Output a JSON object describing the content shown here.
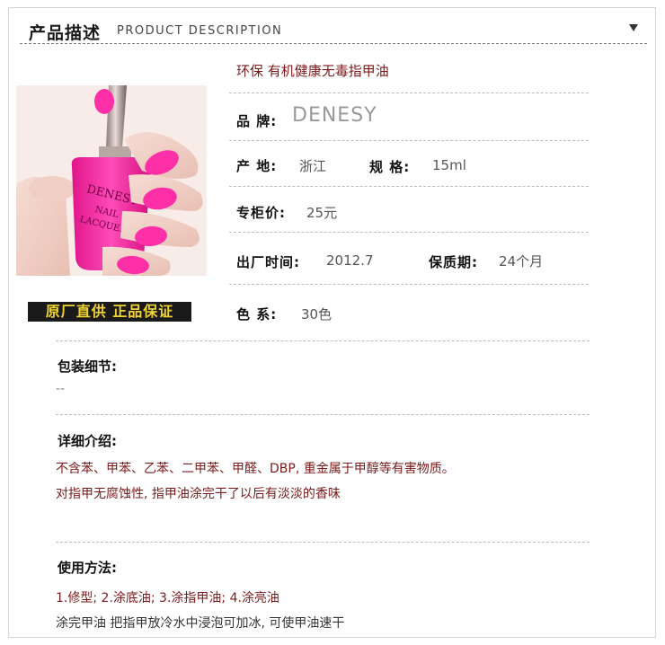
{
  "header": {
    "title_cn": "产品描述",
    "title_en": "PRODUCT DESCRIPTION"
  },
  "photo": {
    "bottle_brand": "DENESY",
    "bottle_line1": "NAIL",
    "bottle_line2": "LACQUER",
    "polish_color": "#ff2fa8"
  },
  "badge": {
    "text": "原厂直供 正品保证"
  },
  "specs": {
    "title": "环保 有机健康无毒指甲油",
    "brand_label": "品 牌:",
    "brand_value": "DENESY",
    "origin_label": "产 地:",
    "origin_value": "浙江",
    "size_label": "规 格:",
    "size_value": "15ml",
    "price_label": "专柜价:",
    "price_value": "25元",
    "date_label": "出厂时间:",
    "date_value": "2012.7",
    "shelf_label": "保质期:",
    "shelf_value": "24个月",
    "colors_label": "色 系:",
    "colors_value": "30色"
  },
  "packaging": {
    "label": "包装细节:",
    "value": "--"
  },
  "details": {
    "label": "详细介绍:",
    "line1": "不含苯、甲苯、乙苯、二甲苯、甲醛、DBP, 重金属于甲醇等有害物质。",
    "line2": "对指甲无腐蚀性, 指甲油涂完干了以后有淡淡的香味"
  },
  "usage": {
    "label": "使用方法:",
    "line1": "1.修型; 2.涂底油; 3.涂指甲油; 4.涂亮油",
    "line2": "涂完甲油 把指甲放冷水中浸泡可加冰, 可使甲油速干"
  }
}
